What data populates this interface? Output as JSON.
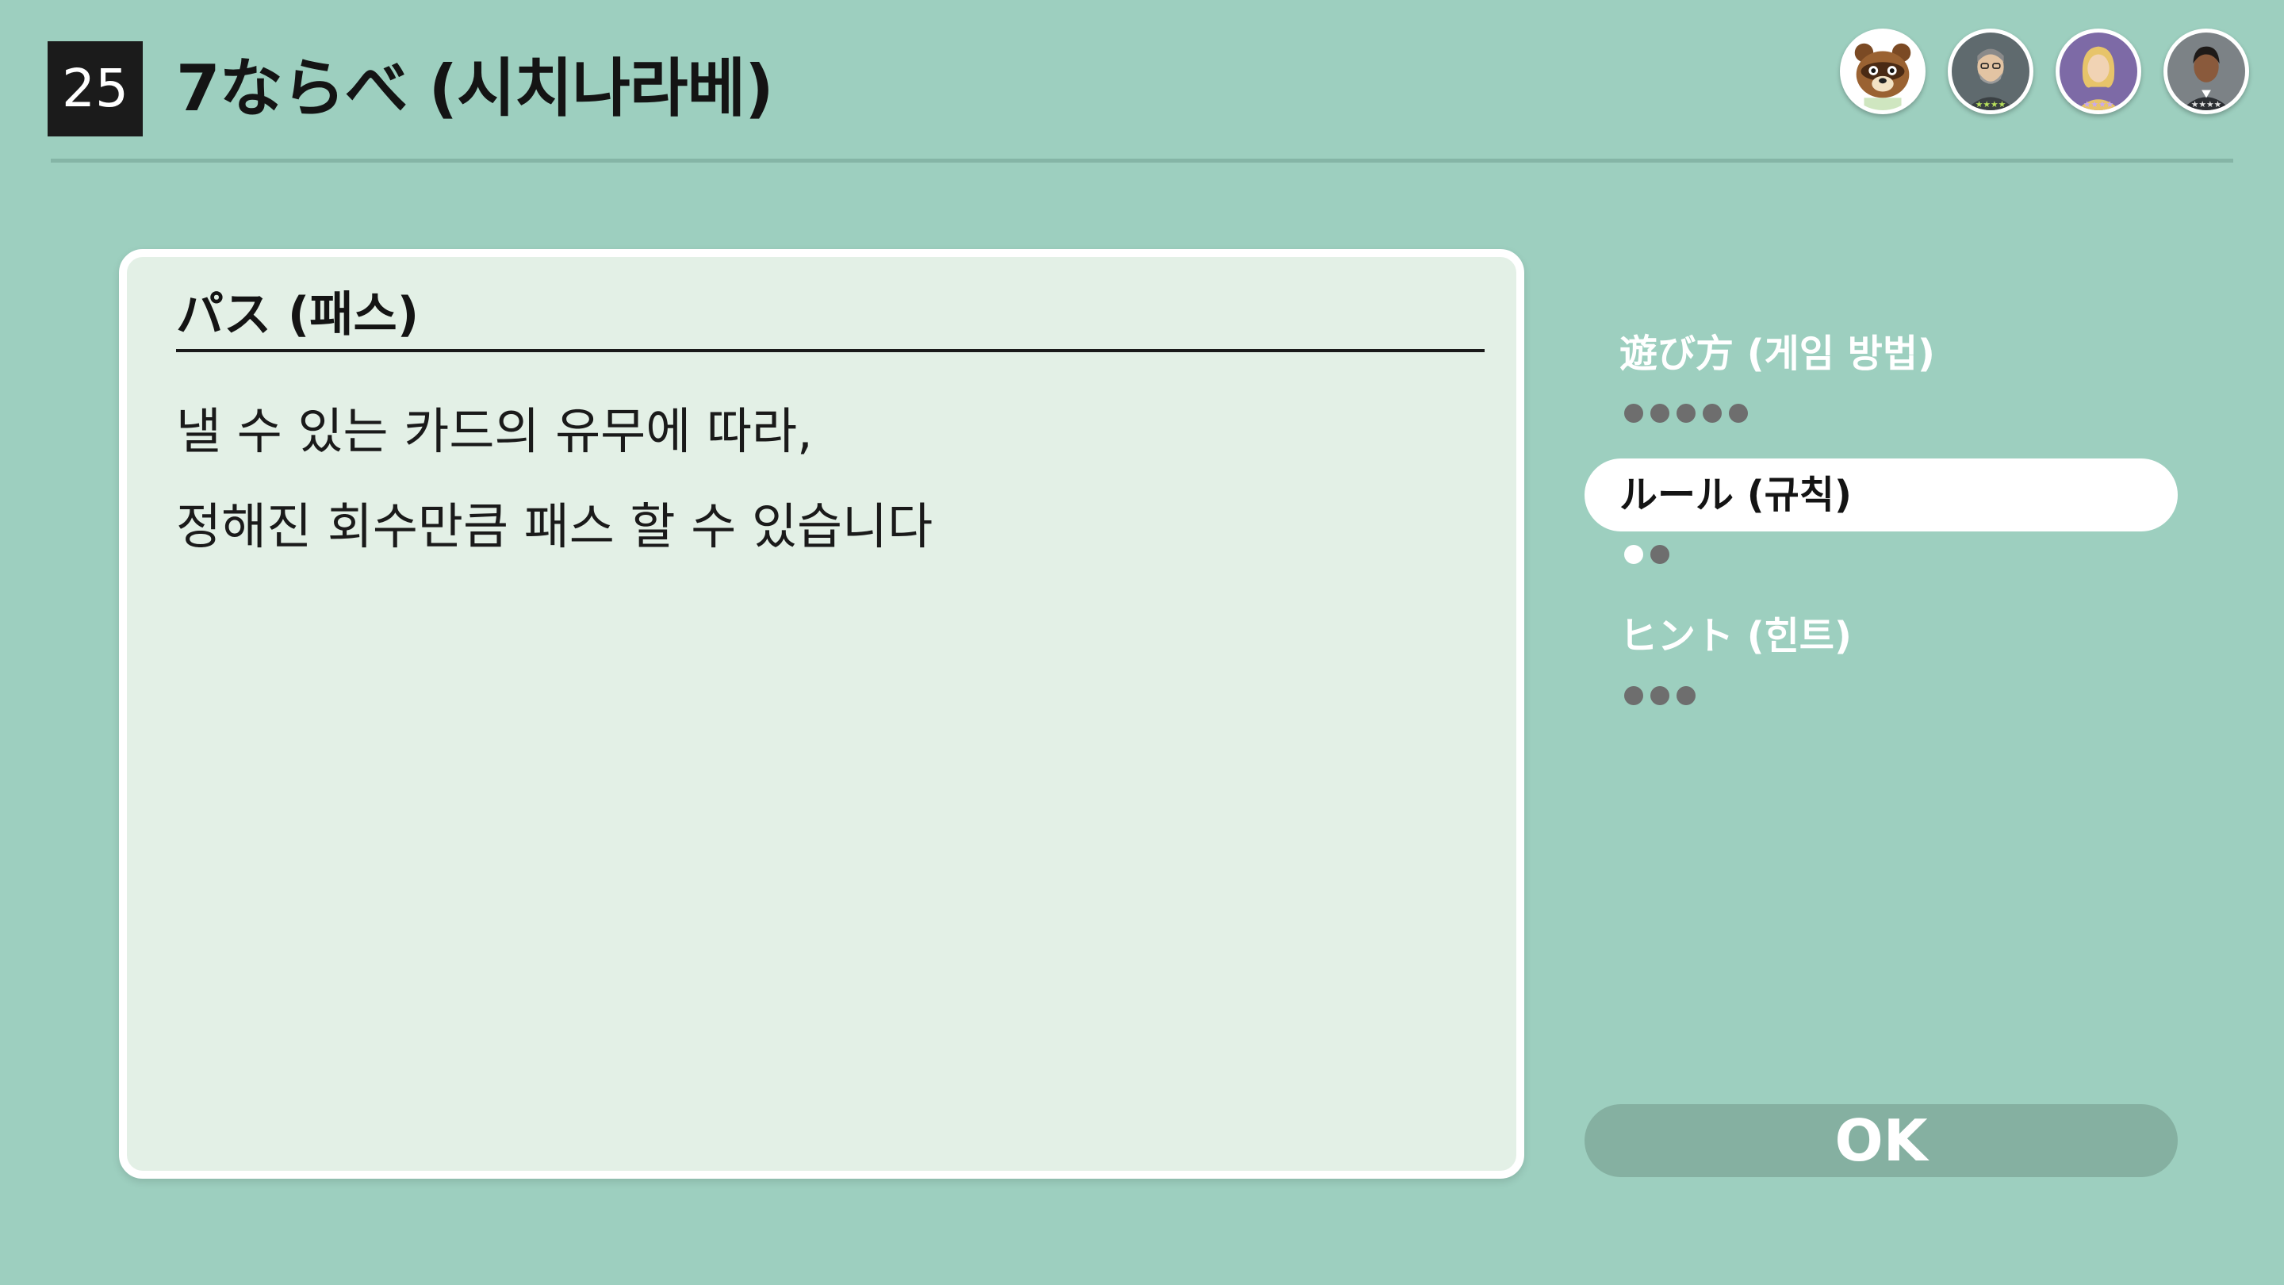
{
  "header": {
    "game_number": "25",
    "game_title": "7ならべ (시치나라베)"
  },
  "players": [
    {
      "name": "tom-nook-avatar",
      "icon": "raccoon-character-icon"
    },
    {
      "name": "player-2-avatar",
      "icon": "bearded-man-icon",
      "stars": 4
    },
    {
      "name": "player-3-avatar",
      "icon": "blonde-woman-icon",
      "stars": 4
    },
    {
      "name": "player-4-avatar",
      "icon": "dark-hair-man-icon",
      "stars": 4
    }
  ],
  "panel": {
    "heading": "パス (패스)",
    "lines": [
      "낼 수 있는 카드의 유무에 따라,",
      "정해진 회수만큼 패스 할 수 있습니다"
    ]
  },
  "menu": {
    "items": [
      {
        "label": "遊び方 (게임 방법)",
        "pages": 5,
        "current_page": 0
      },
      {
        "label": "ルール (규칙)",
        "pages": 2,
        "current_page": 1,
        "selected": true
      },
      {
        "label": "ヒント (힌트)",
        "pages": 3,
        "current_page": 0
      }
    ]
  },
  "ok_label": "OK",
  "colors": {
    "background": "#9dcfbf",
    "panel": "#e3f0e6",
    "ok_button": "#85b0a1",
    "dot": "#6e6e6e"
  }
}
